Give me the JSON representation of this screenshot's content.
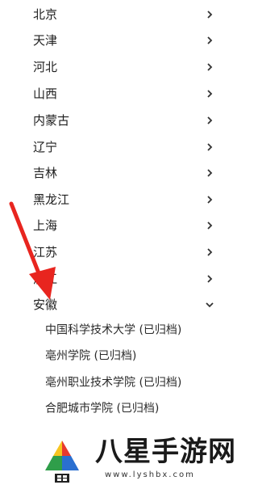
{
  "provinces": [
    {
      "label": "北京",
      "expanded": false
    },
    {
      "label": "天津",
      "expanded": false
    },
    {
      "label": "河北",
      "expanded": false
    },
    {
      "label": "山西",
      "expanded": false
    },
    {
      "label": "内蒙古",
      "expanded": false
    },
    {
      "label": "辽宁",
      "expanded": false
    },
    {
      "label": "吉林",
      "expanded": false
    },
    {
      "label": "黑龙江",
      "expanded": false
    },
    {
      "label": "上海",
      "expanded": false
    },
    {
      "label": "江苏",
      "expanded": false
    },
    {
      "label": "浙江",
      "expanded": false
    },
    {
      "label": "安徽",
      "expanded": true
    }
  ],
  "anhui_schools": [
    "中国科学技术大学 (已归档)",
    "亳州学院 (已归档)",
    "亳州职业技术学院 (已归档)",
    "合肥城市学院 (已归档)"
  ],
  "icons": {
    "collapsed": "chevron-right-icon",
    "expanded": "chevron-down-icon",
    "annotation": "red-arrow-icon"
  },
  "colors": {
    "arrow": "#e8251f",
    "text": "#1f1f1f"
  },
  "watermark": {
    "brand": "八星手游网",
    "url": "www.lyshbx.com"
  }
}
